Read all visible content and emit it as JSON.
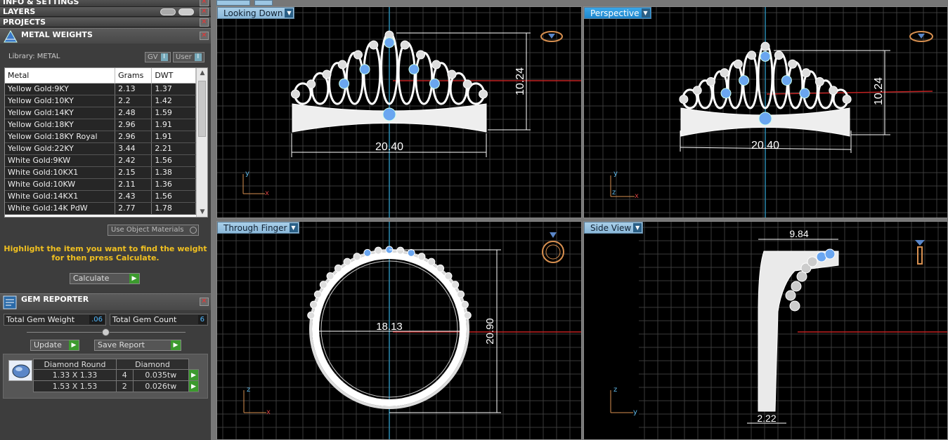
{
  "panels": {
    "info_settings": "INFO & SETTINGS",
    "layers": "LAYERS",
    "projects": "PROJECTS"
  },
  "metal_weights": {
    "title": "METAL WEIGHTS",
    "library_label": "Library: METAL",
    "toggle_gv": "GV",
    "toggle_user": "User",
    "columns": [
      "Metal",
      "Grams",
      "DWT"
    ],
    "rows": [
      [
        "Yellow Gold:9KY",
        "2.13",
        "1.37"
      ],
      [
        "Yellow Gold:10KY",
        "2.2",
        "1.42"
      ],
      [
        "Yellow Gold:14KY",
        "2.48",
        "1.59"
      ],
      [
        "Yellow Gold:18KY",
        "2.96",
        "1.91"
      ],
      [
        "Yellow Gold:18KY Royal",
        "2.96",
        "1.91"
      ],
      [
        "Yellow Gold:22KY",
        "3.44",
        "2.21"
      ],
      [
        "White Gold:9KW",
        "2.42",
        "1.56"
      ],
      [
        "White Gold:10KX1",
        "2.15",
        "1.38"
      ],
      [
        "White Gold:10KW",
        "2.11",
        "1.36"
      ],
      [
        "White Gold:14KX1",
        "2.43",
        "1.56"
      ],
      [
        "White Gold:14K PdW",
        "2.77",
        "1.78"
      ]
    ],
    "use_object_materials": "Use Object Materials",
    "hint_line1": "Highlight the item you want to find the weight",
    "hint_line2": "for then press Calculate.",
    "calculate_label": "Calculate"
  },
  "gem_reporter": {
    "title": "GEM REPORTER",
    "total_weight_label": "Total Gem Weight",
    "total_weight_value": ".06",
    "total_count_label": "Total Gem Count",
    "total_count_value": "6",
    "update_label": "Update",
    "save_report_label": "Save Report",
    "columns": [
      "Diamond Round",
      "Diamond"
    ],
    "rows": [
      [
        "1.33 X 1.33",
        "4",
        "0.035tw"
      ],
      [
        "1.53 X 1.53",
        "2",
        "0.026tw"
      ]
    ]
  },
  "viewports": {
    "looking_down": {
      "label": "Looking Down",
      "width_dim": "20.40",
      "height_dim": "10.24"
    },
    "perspective": {
      "label": "Perspective",
      "width_dim": "20.40",
      "height_dim": "10.24"
    },
    "through_finger": {
      "label": "Through Finger",
      "inner_dim": "18.13",
      "outer_dim": "20.90"
    },
    "side_view": {
      "label": "Side View",
      "top_dim": "9.84",
      "bottom_dim": "2.22"
    }
  },
  "colors": {
    "grid": "#3a3a3a",
    "ring": "#ffffff",
    "gem": "#6aa6f0",
    "axis_red": "#c02020",
    "axis_blue": "#2a8ab0",
    "tab_active": "#1f86cc",
    "hint": "#f0c020"
  }
}
